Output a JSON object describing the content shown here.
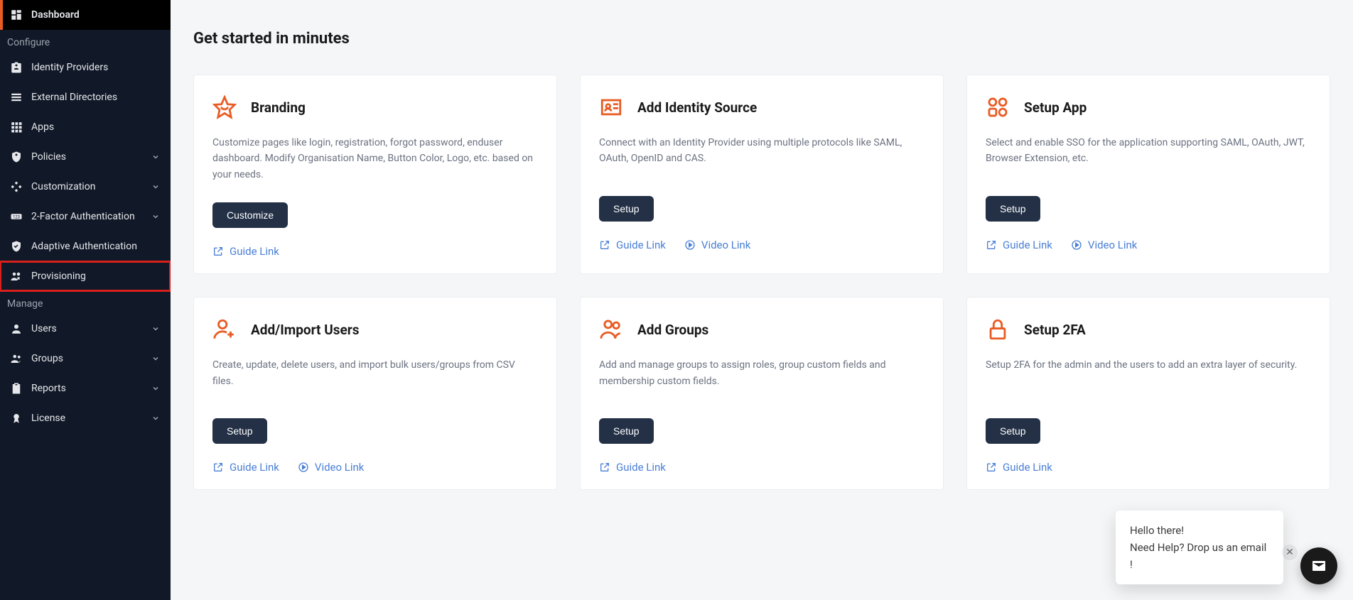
{
  "sidebar": {
    "sections": [
      {
        "type": "item",
        "key": "dashboard",
        "label": "Dashboard",
        "icon": "dashboard",
        "active": true
      },
      {
        "type": "heading",
        "label": "Configure"
      },
      {
        "type": "item",
        "key": "idp",
        "label": "Identity Providers",
        "icon": "badge"
      },
      {
        "type": "item",
        "key": "extdir",
        "label": "External Directories",
        "icon": "rows"
      },
      {
        "type": "item",
        "key": "apps",
        "label": "Apps",
        "icon": "grid"
      },
      {
        "type": "item",
        "key": "policies",
        "label": "Policies",
        "icon": "policy",
        "expandable": true
      },
      {
        "type": "item",
        "key": "customization",
        "label": "Customization",
        "icon": "customize",
        "expandable": true
      },
      {
        "type": "item",
        "key": "2fa",
        "label": "2-Factor Authentication",
        "icon": "twofa",
        "expandable": true
      },
      {
        "type": "item",
        "key": "adaptive",
        "label": "Adaptive Authentication",
        "icon": "shield-check"
      },
      {
        "type": "item",
        "key": "provisioning",
        "label": "Provisioning",
        "icon": "provisioning",
        "highlighted": true
      },
      {
        "type": "heading",
        "label": "Manage"
      },
      {
        "type": "item",
        "key": "users",
        "label": "Users",
        "icon": "user",
        "expandable": true
      },
      {
        "type": "item",
        "key": "groups",
        "label": "Groups",
        "icon": "group",
        "expandable": true
      },
      {
        "type": "item",
        "key": "reports",
        "label": "Reports",
        "icon": "clipboard",
        "expandable": true
      },
      {
        "type": "item",
        "key": "license",
        "label": "License",
        "icon": "award",
        "expandable": true
      }
    ]
  },
  "page": {
    "title": "Get started in minutes"
  },
  "links": {
    "guide": "Guide Link",
    "video": "Video Link"
  },
  "cards": [
    {
      "key": "branding",
      "icon": "star-smile",
      "title": "Branding",
      "desc": "Customize pages like login, registration, forgot password, enduser dashboard. Modify Organisation Name, Button Color, Logo, etc. based on your needs.",
      "button": "Customize",
      "guide": true,
      "video": false
    },
    {
      "key": "identity-source",
      "icon": "id-card",
      "title": "Add Identity Source",
      "desc": "Connect with an Identity Provider using multiple protocols like SAML, OAuth, OpenID and CAS.",
      "button": "Setup",
      "guide": true,
      "video": true
    },
    {
      "key": "setup-app",
      "icon": "four-shapes",
      "title": "Setup App",
      "desc": "Select and enable SSO for the application supporting SAML, OAuth, JWT, Browser Extension, etc.",
      "button": "Setup",
      "guide": true,
      "video": true
    },
    {
      "key": "import-users",
      "icon": "user-plus",
      "title": "Add/Import Users",
      "desc": "Create, update, delete users, and import bulk users/groups from CSV files.",
      "button": "Setup",
      "guide": true,
      "video": true
    },
    {
      "key": "add-groups",
      "icon": "people",
      "title": "Add Groups",
      "desc": "Add and manage groups to assign roles, group custom fields and membership custom fields.",
      "button": "Setup",
      "guide": true,
      "video": false
    },
    {
      "key": "setup-2fa",
      "icon": "lock",
      "title": "Setup 2FA",
      "desc": "Setup 2FA for the admin and the users to add an extra layer of security.",
      "button": "Setup",
      "guide": true,
      "video": false
    }
  ],
  "chat": {
    "line1": "Hello there!",
    "line2": "Need Help? Drop us an email !"
  }
}
